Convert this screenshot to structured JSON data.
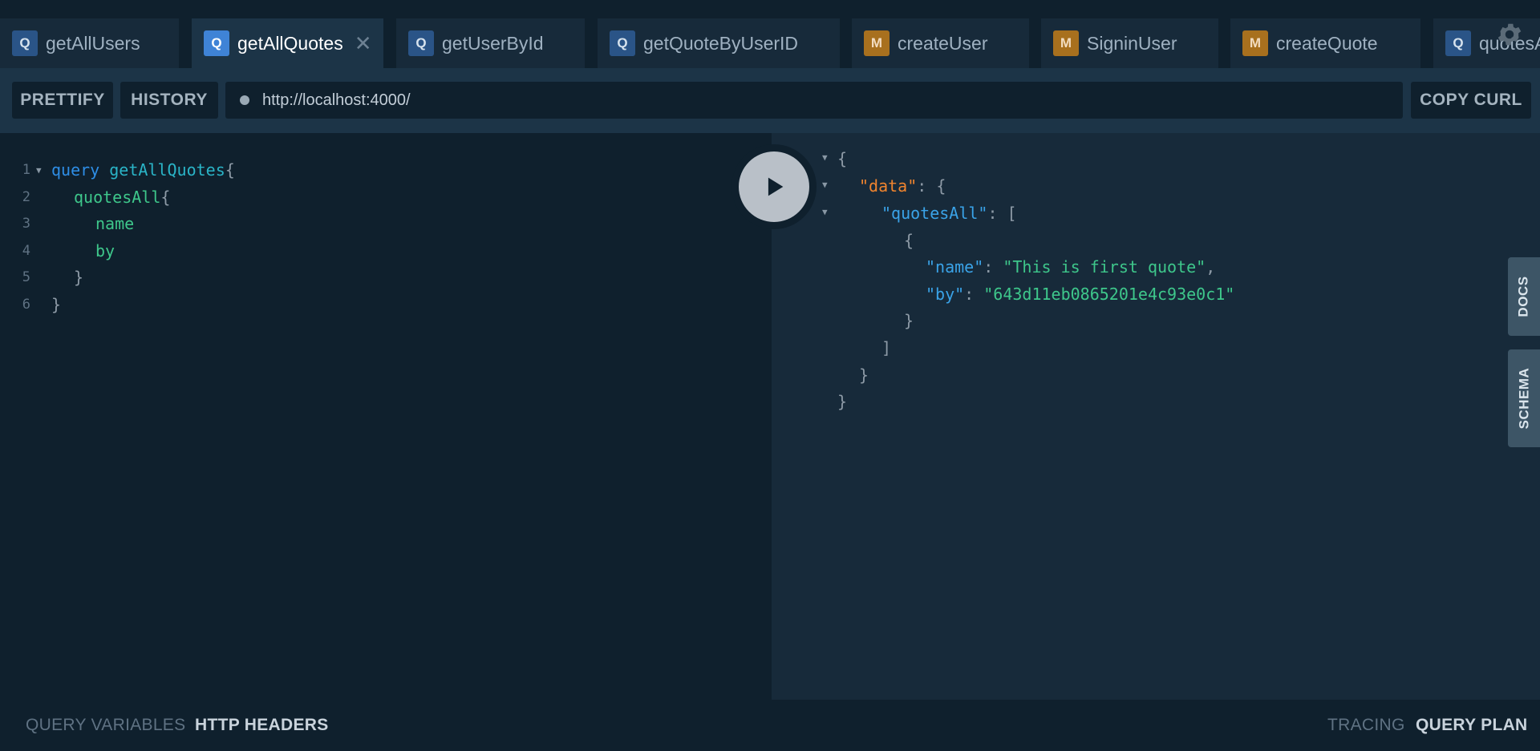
{
  "tabs": [
    {
      "type": "Q",
      "label": "getAllUsers"
    },
    {
      "type": "Q",
      "label": "getAllQuotes",
      "active": true,
      "close": "✕"
    },
    {
      "type": "Q",
      "label": "getUserById"
    },
    {
      "type": "Q",
      "label": "getQuoteByUserID"
    },
    {
      "type": "M",
      "label": "createUser"
    },
    {
      "type": "M",
      "label": "SigninUser"
    },
    {
      "type": "M",
      "label": "createQuote"
    },
    {
      "type": "Q",
      "label": "quotesAll"
    }
  ],
  "toolbar": {
    "prettify": "PRETTIFY",
    "history": "HISTORY",
    "url": "http://localhost:4000/",
    "copy_curl": "COPY CURL"
  },
  "editor": {
    "line_numbers": [
      "1",
      "2",
      "3",
      "4",
      "5",
      "6"
    ],
    "line1": {
      "kw": "query",
      "name": "getAllQuotes",
      "brace": "{"
    },
    "line2": {
      "field": "quotesAll",
      "brace": "{"
    },
    "line3": "name",
    "line4": "by",
    "line5": "}",
    "line6": "}"
  },
  "result": {
    "open": "{",
    "data_key": "\"data\"",
    "colon_brace": ": {",
    "quotes_key": "\"quotesAll\"",
    "colon_bracket": ": [",
    "obj_open": "{",
    "name_key": "\"name\"",
    "name_val": "\"This is first quote\"",
    "by_key": "\"by\"",
    "by_val": "\"643d11eb0865201e4c93e0c1\"",
    "colon": ": ",
    "comma": ",",
    "obj_close": "}",
    "arr_close": "]",
    "data_close": "}",
    "close": "}"
  },
  "side_tabs": {
    "docs": "DOCS",
    "schema": "SCHEMA"
  },
  "footer": {
    "query_variables": "QUERY VARIABLES",
    "http_headers": "HTTP HEADERS",
    "tracing": "TRACING",
    "query_plan": "QUERY PLAN"
  },
  "icons": {
    "settings": "gear-icon",
    "run": "play-icon"
  },
  "colors": {
    "query_badge": "#2a5487",
    "mutation_badge": "#a8701e",
    "keyword": "#2e8ee6",
    "string": "#3ec78b",
    "data_key": "#f0842e"
  }
}
